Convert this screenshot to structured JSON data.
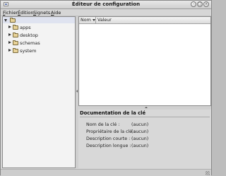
{
  "window": {
    "title": "Éditeur de configuration"
  },
  "menubar": [
    "Fichier",
    "Édition",
    "Signets",
    "Aide"
  ],
  "tree": {
    "items": [
      {
        "label": "apps"
      },
      {
        "label": "desktop"
      },
      {
        "label": "schemas"
      },
      {
        "label": "system"
      }
    ]
  },
  "list": {
    "columns": [
      "Nom",
      "Valeur"
    ]
  },
  "documentation": {
    "title": "Documentation de la clé",
    "rows": [
      {
        "key": "Nom de la clé :",
        "value": "(aucun)"
      },
      {
        "key": "Propriétaire de la clé :",
        "value": "(aucun)"
      },
      {
        "key": "Description courte :",
        "value": "(aucun)"
      },
      {
        "key": "Description longue :",
        "value": "(aucun)"
      }
    ]
  },
  "icons": [
    "app-window-icon",
    "folder-icon",
    "expander-icon",
    "sort-arrow-icon",
    "minimize-icon",
    "maximize-icon",
    "close-icon"
  ],
  "colors": {
    "tree_selected_row": "#dfe3f0",
    "folder": "#e8d39a"
  }
}
